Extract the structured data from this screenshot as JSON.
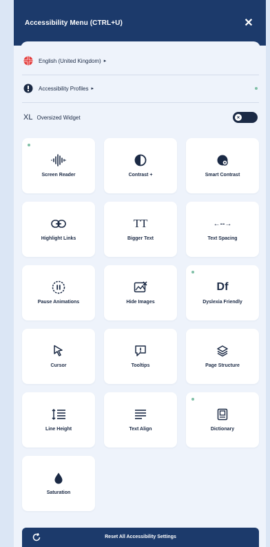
{
  "header": {
    "title": "Accessibility Menu (CTRL+U)",
    "close_icon": "close-icon"
  },
  "language": {
    "label": "English (United Kingdom)",
    "arrow": "▸",
    "icon": "uk-flag-icon"
  },
  "profiles": {
    "label": "Accessibility Profiles",
    "arrow": "▸",
    "icon": "profiles-icon"
  },
  "oversized": {
    "xl": "XL",
    "label": "Oversized Widget",
    "enabled": false,
    "knob_icon": "close-icon"
  },
  "tiles": [
    {
      "label": "Screen Reader",
      "icon": "audio-waveform-icon",
      "dot": true
    },
    {
      "label": "Contrast +",
      "icon": "contrast-icon",
      "dot": false
    },
    {
      "label": "Smart Contrast",
      "icon": "smart-contrast-icon",
      "dot": false
    },
    {
      "label": "Highlight Links",
      "icon": "link-icon",
      "dot": false
    },
    {
      "label": "Bigger Text",
      "icon": "text-size-icon",
      "dot": false
    },
    {
      "label": "Text Spacing",
      "icon": "text-spacing-icon",
      "dot": false
    },
    {
      "label": "Pause Animations",
      "icon": "pause-icon",
      "dot": false
    },
    {
      "label": "Hide Images",
      "icon": "hide-image-icon",
      "dot": false
    },
    {
      "label": "Dyslexia Friendly",
      "icon": "dyslexia-font-icon",
      "dot": true
    },
    {
      "label": "Cursor",
      "icon": "cursor-icon",
      "dot": false
    },
    {
      "label": "Tooltips",
      "icon": "tooltip-icon",
      "dot": false
    },
    {
      "label": "Page Structure",
      "icon": "layers-icon",
      "dot": false
    },
    {
      "label": "Line Height",
      "icon": "line-height-icon",
      "dot": false
    },
    {
      "label": "Text Align",
      "icon": "text-align-icon",
      "dot": false
    },
    {
      "label": "Dictionary",
      "icon": "dictionary-icon",
      "dot": true
    },
    {
      "label": "Saturation",
      "icon": "drop-icon",
      "dot": false
    }
  ],
  "tile_glyphs": {
    "bigger_text": "TT",
    "dyslexia": "Df",
    "text_spacing": "←--→"
  },
  "reset": {
    "label": "Reset All Accessibility Settings",
    "icon": "reset-icon"
  },
  "colors": {
    "brand": "#1c3a6b",
    "background": "#dbe6f5",
    "panel": "#eef3fb",
    "tile": "#ffffff",
    "indicator": "#7fbfa6"
  }
}
